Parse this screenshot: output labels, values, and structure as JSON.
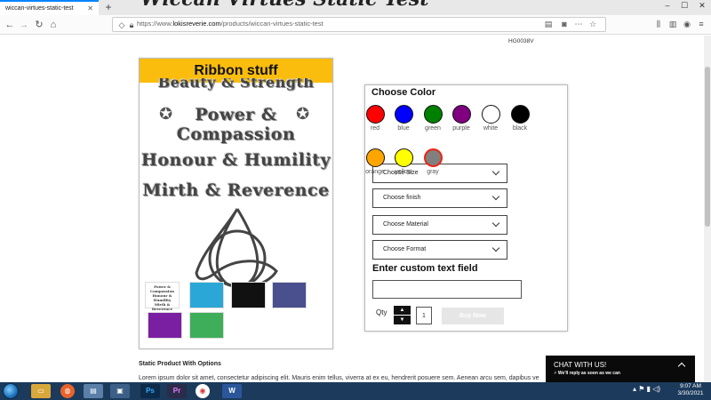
{
  "browser": {
    "tab_title": "wiccan-virtues-static-test",
    "tab_close": "✕",
    "new_tab": "+",
    "url_prefix": "https://www.",
    "url_host": "lokisreverie.com",
    "url_path": "/products/wiccan-virtues-static-test",
    "window_controls": [
      "–",
      "☐",
      "✕"
    ]
  },
  "product": {
    "title": "Wiccan Virtues Static Test",
    "sku": "HG0038V",
    "image_header": "Ribbon stuff",
    "image_lines": [
      "Beauty & Strength",
      "Power &",
      "Compassion",
      "Honour & Humility",
      "Mirth & Reverence"
    ],
    "thumb_lines": [
      "Power &",
      "Compassion",
      "Honour & Humility",
      "Mirth & Reverence"
    ],
    "thumbnails": [
      {
        "color": "#ffffff"
      },
      {
        "color": "#2aa7d6"
      },
      {
        "color": "#111111"
      },
      {
        "color": "#4a4f8e"
      },
      {
        "color": "#7b1fa2"
      },
      {
        "color": "#3fae5a"
      }
    ]
  },
  "options": {
    "choose_color_label": "Choose Color",
    "colors": [
      {
        "name": "red",
        "hex": "#ff0000"
      },
      {
        "name": "blue",
        "hex": "#0000ff"
      },
      {
        "name": "green",
        "hex": "#008000"
      },
      {
        "name": "purple",
        "hex": "#800080"
      },
      {
        "name": "white",
        "hex": "#ffffff"
      },
      {
        "name": "black",
        "hex": "#000000"
      },
      {
        "name": "orange",
        "hex": "#ffa500"
      },
      {
        "name": "yellow",
        "hex": "#ffff00"
      },
      {
        "name": "gray",
        "hex": "#808080"
      }
    ],
    "selected_color": "gray",
    "dropdowns": [
      "Choose Size",
      "Choose finish",
      "Choose Material",
      "Choose Format"
    ],
    "custom_text_label": "Enter custom text field",
    "custom_text_value": "",
    "qty_label": "Qty",
    "qty_value": "1",
    "qty_up": "▲",
    "qty_down": "▼",
    "buy_now": "Buy Now"
  },
  "description": {
    "heading": "Static Product With Options",
    "text": "Lorem ipsum dolor sit amet, consectetur adipiscing elit. Mauris enim tellus, viverra at ex eu, hendrerit posuere sem. Aenean arcu sem, dapibus ve"
  },
  "chat": {
    "title": "CHAT WITH US!",
    "subtitle": "We'll reply as soon as we can"
  },
  "taskbar": {
    "apps": [
      "Ps",
      "Pr",
      "W"
    ],
    "clock_time": "9:07 AM",
    "clock_date": "3/30/2021"
  },
  "colors": {
    "ribbon_bg": "#fbbd0d",
    "tab_accent": "#0a84ff",
    "taskbar": "#1c3b5c",
    "chat_bg": "#0a0a0a"
  }
}
